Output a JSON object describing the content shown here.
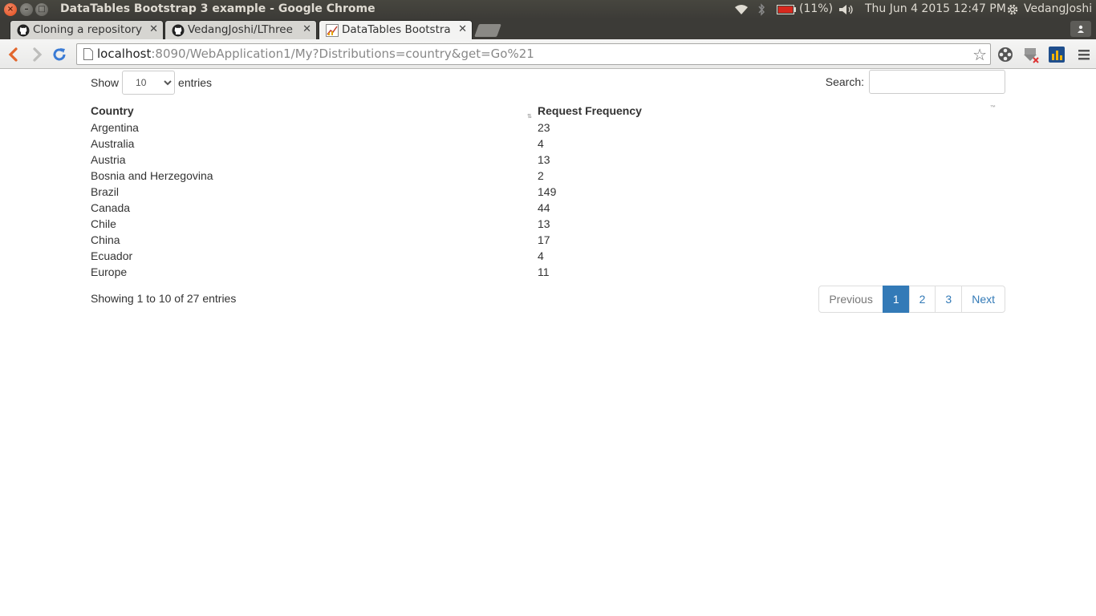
{
  "window": {
    "title": "DataTables Bootstrap 3 example - Google Chrome",
    "indicators": {
      "battery": "(11%)",
      "datetime": "Thu Jun  4 2015 12:47 PM",
      "user": "VedangJoshi"
    }
  },
  "tabs": [
    {
      "label": "Cloning a repository",
      "icon": "github-icon"
    },
    {
      "label": "VedangJoshi/LThree",
      "icon": "github-icon"
    },
    {
      "label": "DataTables Bootstra",
      "icon": "chart-icon"
    }
  ],
  "address_bar": {
    "host": "localhost",
    "path": ":8090/WebApplication1/My?Distributions=country&get=Go%21"
  },
  "datatable": {
    "length_label_before": "Show",
    "length_value": "10",
    "length_label_after": "entries",
    "search_label": "Search:",
    "search_value": "",
    "columns": [
      "Country",
      "Request Frequency"
    ],
    "rows": [
      [
        "Argentina",
        "23"
      ],
      [
        "Australia",
        "4"
      ],
      [
        "Austria",
        "13"
      ],
      [
        "Bosnia and Herzegovina",
        "2"
      ],
      [
        "Brazil",
        "149"
      ],
      [
        "Canada",
        "44"
      ],
      [
        "Chile",
        "13"
      ],
      [
        "China",
        "17"
      ],
      [
        "Ecuador",
        "4"
      ],
      [
        "Europe",
        "11"
      ]
    ],
    "info": "Showing 1 to 10 of 27 entries",
    "pagination": {
      "previous": "Previous",
      "pages": [
        "1",
        "2",
        "3"
      ],
      "current": "1",
      "next": "Next"
    },
    "accent_color": "#337ab7"
  }
}
